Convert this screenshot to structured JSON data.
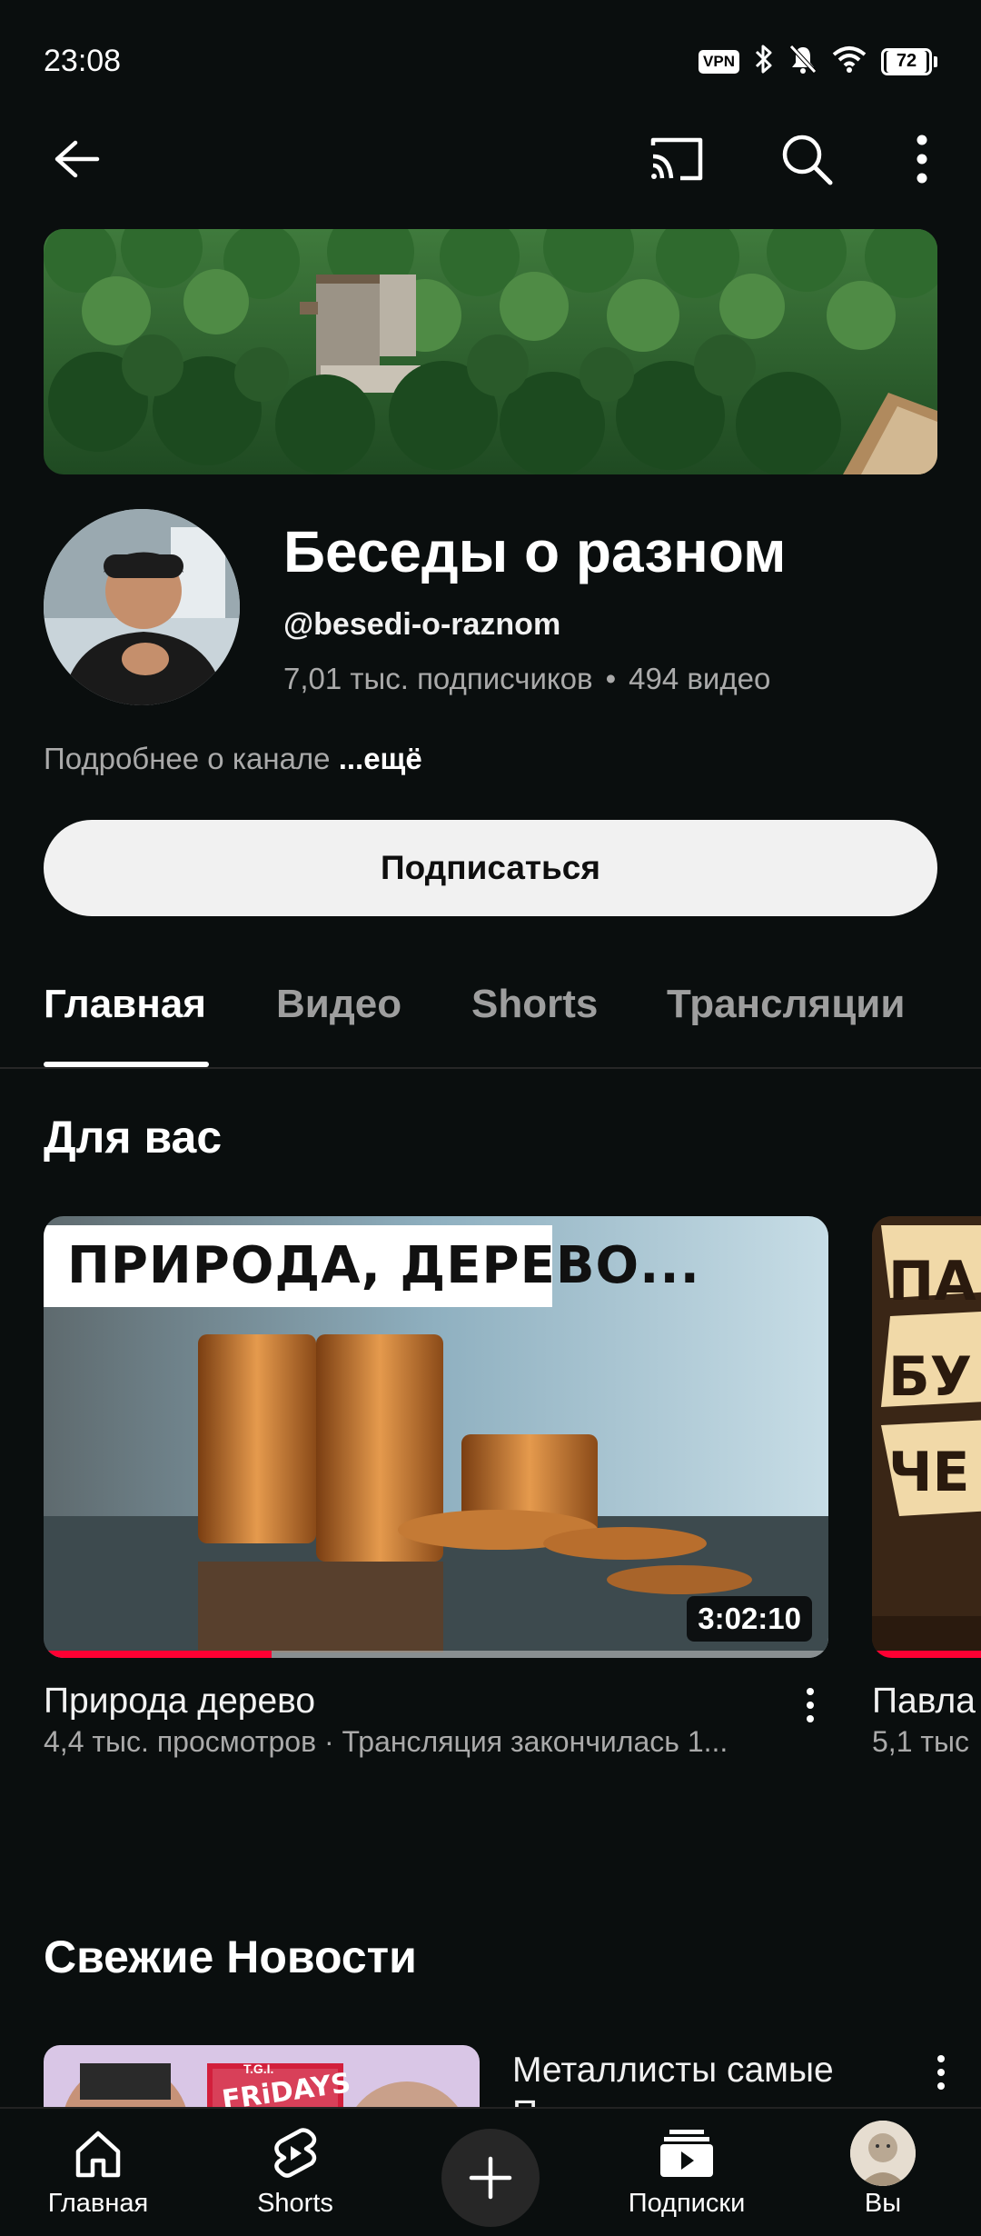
{
  "status_bar": {
    "time": "23:08",
    "vpn_label": "VPN",
    "battery_level": "72",
    "icons": [
      "vpn-icon",
      "bluetooth-icon",
      "mute-icon",
      "wifi-icon",
      "battery-icon"
    ]
  },
  "top_bar": {
    "icons": [
      "back-arrow-icon",
      "cast-icon",
      "search-icon",
      "more-vertical-icon"
    ]
  },
  "channel": {
    "name": "Беседы о разном",
    "handle": "@besedi-o-raznom",
    "subscribers": "7,01 тыс. подписчиков",
    "separator": "•",
    "video_count": "494 видео",
    "about_text": "Подробнее о канале ",
    "about_more": "...ещё",
    "subscribe_label": "Подписаться"
  },
  "tabs": [
    {
      "label": "Главная",
      "active": true
    },
    {
      "label": "Видео",
      "active": false
    },
    {
      "label": "Shorts",
      "active": false
    },
    {
      "label": "Трансляции",
      "active": false
    }
  ],
  "sections": {
    "for_you": "Для вас",
    "fresh_news": "Свежие Новости"
  },
  "videos": [
    {
      "thumb_text": "ПРИРОДА, ДЕРЕВО...",
      "duration": "3:02:10",
      "progress": 0.29,
      "title": "Природа дерево",
      "meta": "4,4 тыс. просмотров · Трансляция закончилась 1..."
    },
    {
      "thumb_text": "ПА БУ ЧЕ",
      "title": "Павла",
      "meta": "5,1 тыс"
    }
  ],
  "news": {
    "title": "Металлисты самые",
    "title_line2": "П",
    "thumb_sign": "FRiDAYS",
    "thumb_sign_small": "T.G.I."
  },
  "bottom_nav": [
    {
      "label": "Главная",
      "icon": "home-icon"
    },
    {
      "label": "Shorts",
      "icon": "shorts-icon"
    },
    {
      "label": "",
      "icon": "plus-icon"
    },
    {
      "label": "Подписки",
      "icon": "subscriptions-icon"
    },
    {
      "label": "Вы",
      "icon": "avatar-icon"
    }
  ],
  "colors": {
    "background": "#0a0e0e",
    "accent": "#ff0033",
    "button_bg": "#f1f1f1"
  }
}
